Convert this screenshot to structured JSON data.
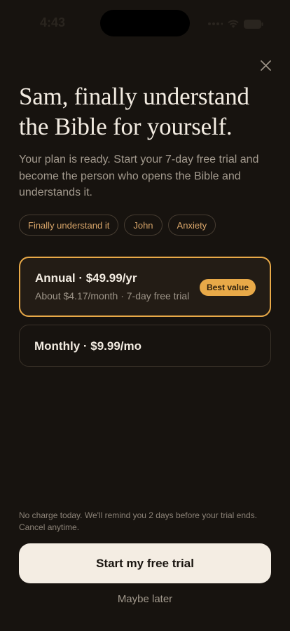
{
  "status_bar": {
    "time": "4:43",
    "icons": [
      "signal-dots-icon",
      "wifi-icon",
      "battery-icon"
    ]
  },
  "header": {
    "close_icon": "close-icon",
    "headline": "Sam, finally understand the Bible for yourself.",
    "subtitle": "Your plan is ready. Start your 7-day free trial and become the person who opens the Bible and understands it."
  },
  "chips": [
    {
      "label": "Finally understand it"
    },
    {
      "label": "John"
    },
    {
      "label": "Anxiety"
    }
  ],
  "plans": {
    "annual": {
      "title": "Annual · $49.99/yr",
      "detail": "About $4.17/month · 7-day free trial",
      "badge": "Best value",
      "selected": true
    },
    "monthly": {
      "title": "Monthly · $9.99/mo",
      "selected": false
    }
  },
  "footer": {
    "fine_print": "No charge today. We'll remind you 2 days before your trial ends. Cancel anytime.",
    "cta_label": "Start my free trial",
    "secondary_label": "Maybe later"
  },
  "colors": {
    "background": "#17130f",
    "accent": "#e8a948",
    "chip_text": "#d9a66a",
    "cta_background": "#f4ede3"
  }
}
